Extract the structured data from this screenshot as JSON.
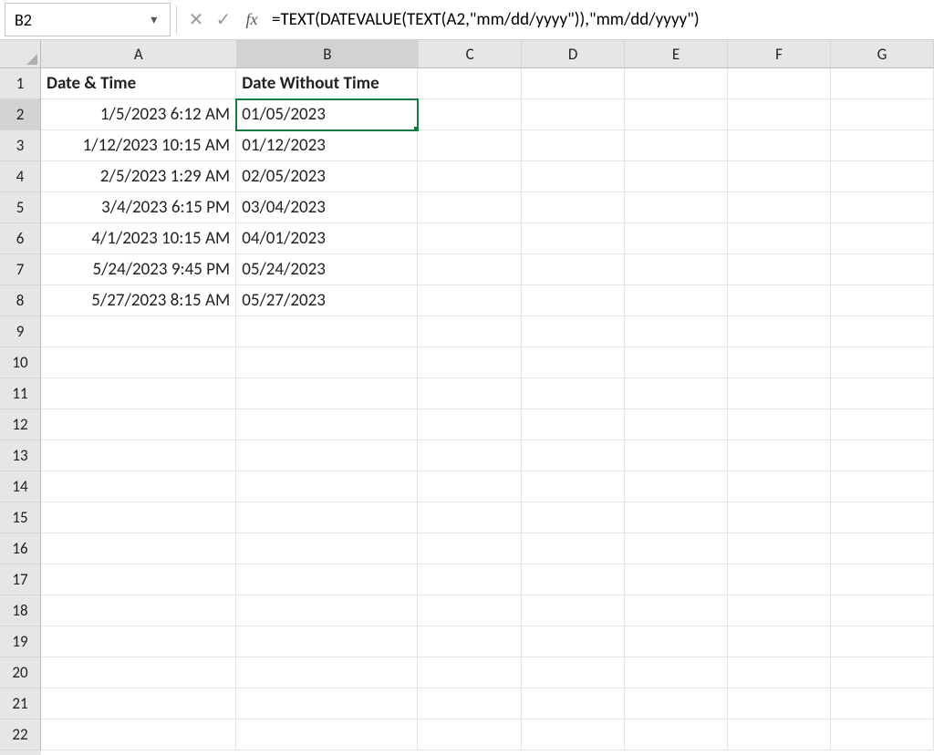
{
  "nameBox": {
    "value": "B2"
  },
  "formulaBar": {
    "cancel": "✕",
    "confirm": "✓",
    "fx": "fx",
    "formula": "=TEXT(DATEVALUE(TEXT(A2,\"mm/dd/yyyy\")),\"mm/dd/yyyy\")"
  },
  "columns": [
    "A",
    "B",
    "C",
    "D",
    "E",
    "F",
    "G"
  ],
  "visibleRowCount": 22,
  "activeCell": {
    "row": 2,
    "col": "B"
  },
  "headers": {
    "A": "Date & Time",
    "B": "Date Without Time"
  },
  "rows": [
    {
      "A": "1/5/2023 6:12 AM",
      "B": "01/05/2023"
    },
    {
      "A": "1/12/2023 10:15 AM",
      "B": "01/12/2023"
    },
    {
      "A": "2/5/2023 1:29 AM",
      "B": "02/05/2023"
    },
    {
      "A": "3/4/2023 6:15 PM",
      "B": "03/04/2023"
    },
    {
      "A": "4/1/2023 10:15 AM",
      "B": "04/01/2023"
    },
    {
      "A": "5/24/2023 9:45 PM",
      "B": "05/24/2023"
    },
    {
      "A": "5/27/2023 8:15 AM",
      "B": "05/27/2023"
    }
  ],
  "colWidths": {
    "A": "cA",
    "B": "cB",
    "C": "cC",
    "D": "cD",
    "E": "cE",
    "F": "cF",
    "G": "cG"
  }
}
